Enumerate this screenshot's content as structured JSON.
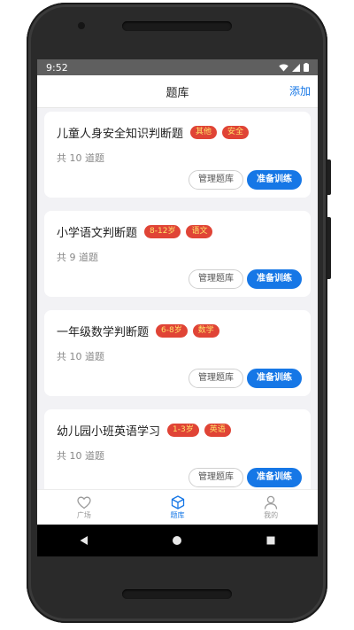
{
  "status": {
    "time": "9:52"
  },
  "header": {
    "title": "题库",
    "add_label": "添加"
  },
  "banks": [
    {
      "title": "儿童人身安全知识判断题",
      "tags": [
        "其他",
        "安全"
      ],
      "count": "共 10 道题"
    },
    {
      "title": "小学语文判断题",
      "tags": [
        "8-12岁",
        "语文"
      ],
      "count": "共 9 道题"
    },
    {
      "title": "一年级数学判断题",
      "tags": [
        "6-8岁",
        "数学"
      ],
      "count": "共 10 道题"
    },
    {
      "title": "幼儿园小班英语学习",
      "tags": [
        "1-3岁",
        "英语"
      ],
      "count": "共 10 道题"
    }
  ],
  "buttons": {
    "manage": "管理题库",
    "train": "准备训练"
  },
  "tabs": [
    {
      "label": "广场",
      "icon": "heart-icon"
    },
    {
      "label": "题库",
      "icon": "cube-icon"
    },
    {
      "label": "我的",
      "icon": "person-icon"
    }
  ],
  "colors": {
    "accent": "#1677e6",
    "tag": "#e04436",
    "tag_text": "#ffe36a"
  }
}
